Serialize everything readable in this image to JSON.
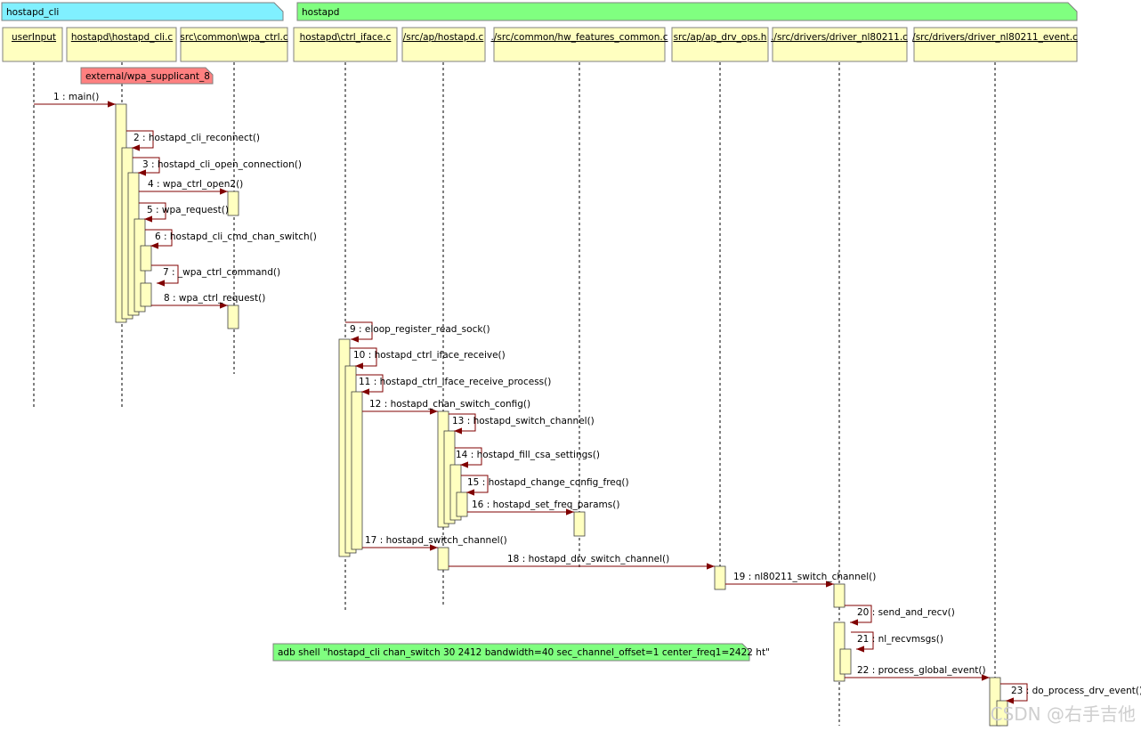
{
  "packages": [
    {
      "id": "cli",
      "name": "hostapd_cli",
      "color": "#80f0ff"
    },
    {
      "id": "hostapd",
      "name": "hostapd",
      "color": "#80ff80"
    }
  ],
  "lifelines": [
    {
      "id": "userInput",
      "name": "userInput"
    },
    {
      "id": "cli_c",
      "name": "hostapd\\hostapd_cli.c"
    },
    {
      "id": "wpa_ctrl",
      "name": "src\\common\\wpa_ctrl.c"
    },
    {
      "id": "ctrl_iface",
      "name": "hostapd\\ctrl_iface.c"
    },
    {
      "id": "ap_hostapd",
      "name": "/src/ap/hostapd.c"
    },
    {
      "id": "hw_features",
      "name": "./src/common/hw_features_common.c"
    },
    {
      "id": "ap_drv_ops",
      "name": "src/ap/ap_drv_ops.h"
    },
    {
      "id": "driver_nl",
      "name": "./src/drivers/driver_nl80211.c"
    },
    {
      "id": "driver_nl_event",
      "name": "/src/drivers/driver_nl80211_event.c"
    }
  ],
  "notes": [
    {
      "id": "note-supplicant",
      "text": "external/wpa_supplicant_8",
      "color": "#ff8080"
    },
    {
      "id": "note-adb",
      "text": "adb shell \"hostapd_cli chan_switch 30 2412 bandwidth=40 sec_channel_offset=1 center_freq1=2422 ht\"",
      "color": "#80ff80"
    }
  ],
  "messages": [
    {
      "n": "1",
      "label": "main()"
    },
    {
      "n": "2",
      "label": "hostapd_cli_reconnect()"
    },
    {
      "n": "3",
      "label": "hostapd_cli_open_connection()"
    },
    {
      "n": "4",
      "label": "wpa_ctrl_open2()"
    },
    {
      "n": "5",
      "label": "wpa_request()"
    },
    {
      "n": "6",
      "label": "hostapd_cli_cmd_chan_switch()"
    },
    {
      "n": "7",
      "label": "_wpa_ctrl_command()"
    },
    {
      "n": "8",
      "label": "wpa_ctrl_request()"
    },
    {
      "n": "9",
      "label": "eloop_register_read_sock()"
    },
    {
      "n": "10",
      "label": "hostapd_ctrl_iface_receive()"
    },
    {
      "n": "11",
      "label": "hostapd_ctrl_iface_receive_process()"
    },
    {
      "n": "12",
      "label": "hostapd_chan_switch_config()"
    },
    {
      "n": "13",
      "label": "hostapd_switch_channel()"
    },
    {
      "n": "14",
      "label": "hostapd_fill_csa_settings()"
    },
    {
      "n": "15",
      "label": "hostapd_change_config_freq()"
    },
    {
      "n": "16",
      "label": "hostapd_set_freq_params()"
    },
    {
      "n": "17",
      "label": "hostapd_switch_channel()"
    },
    {
      "n": "18",
      "label": "hostapd_drv_switch_channel()"
    },
    {
      "n": "19",
      "label": "nl80211_switch_channel()"
    },
    {
      "n": "20",
      "label": "send_and_recv()"
    },
    {
      "n": "21",
      "label": "nl_recvmsgs()"
    },
    {
      "n": "22",
      "label": "process_global_event()"
    },
    {
      "n": "23",
      "label": "do_process_drv_event()"
    }
  ],
  "watermark": "CSDN @右手吉他",
  "colors": {
    "activation": "#ffffc0",
    "lifeline_head": "#ffffc0",
    "arrow": "#800000",
    "border": "#808080"
  }
}
